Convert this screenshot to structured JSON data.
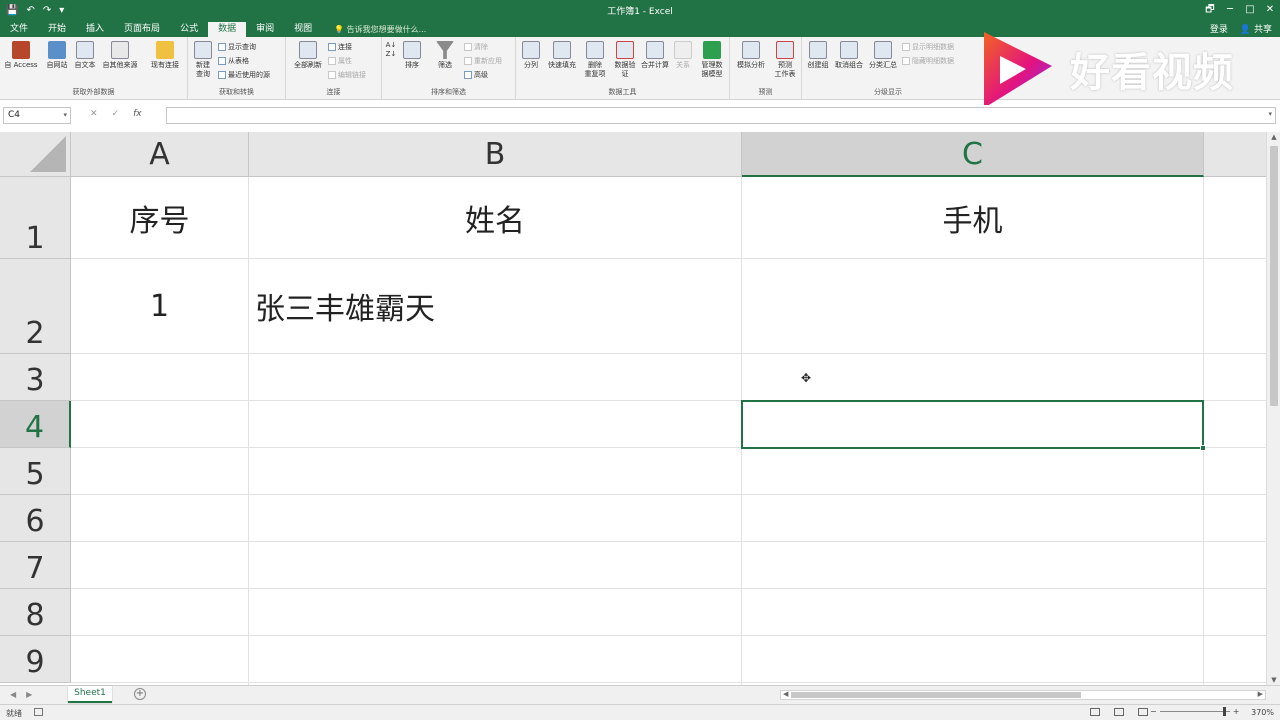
{
  "window": {
    "title": "工作簿1 - Excel",
    "qat": [
      "💾",
      "↶",
      "↷",
      "▾"
    ],
    "controls": [
      "🗗",
      "─",
      "□",
      "✕"
    ]
  },
  "tabs": {
    "items": [
      "文件",
      "开始",
      "插入",
      "页面布局",
      "公式",
      "数据",
      "审阅",
      "视图"
    ],
    "active_index": 5,
    "tell_me": "告诉我您想要做什么...",
    "login": "登录",
    "share": "共享"
  },
  "ribbon": {
    "groups": [
      {
        "label": "获取外部数据",
        "buttons": [
          "自 Access",
          "自网站",
          "自文本",
          "自其他来源",
          "现有连接"
        ]
      },
      {
        "label": "获取和转换",
        "buttons": [
          "新建\n查询"
        ],
        "small": [
          "显示查询",
          "从表格",
          "最近使用的源"
        ]
      },
      {
        "label": "连接",
        "buttons": [
          "全部刷新"
        ],
        "small": [
          "连接",
          "属性",
          "编辑链接"
        ]
      },
      {
        "label": "排序和筛选",
        "buttons": [
          "排序",
          "筛选"
        ],
        "small": [
          "清除",
          "重新应用",
          "高级"
        ]
      },
      {
        "label": "数据工具",
        "buttons": [
          "分列",
          "快速填充",
          "删除\n重复项",
          "数据验\n证",
          "合并计算",
          "关系",
          "管理数\n据模型"
        ]
      },
      {
        "label": "预测",
        "buttons": [
          "模拟分析",
          "预测\n工作表"
        ]
      },
      {
        "label": "分级显示",
        "buttons": [
          "创建组",
          "取消组合",
          "分类汇总"
        ],
        "small": [
          "显示明细数据",
          "隐藏明细数据"
        ]
      }
    ]
  },
  "watermark": {
    "text": "好看视频",
    "colors": {
      "magenta": "#e3137f",
      "orange": "#f26522",
      "purple": "#7b2ff2"
    }
  },
  "formula_bar": {
    "name_box": "C4",
    "cancel": "✕",
    "enter": "✓",
    "fx": "fx",
    "value": ""
  },
  "grid": {
    "columns": [
      "A",
      "B",
      "C"
    ],
    "selected_column": "C",
    "rows": [
      "1",
      "2",
      "3",
      "4",
      "5",
      "6",
      "7",
      "8",
      "9"
    ],
    "selected_row": "4",
    "cells": {
      "A1": "序号",
      "B1": "姓名",
      "C1": "手机",
      "A2": "1",
      "B2": "张三丰雄霸天"
    },
    "active_cell": "C4"
  },
  "sheets": {
    "tabs": [
      "Sheet1"
    ],
    "active": "Sheet1",
    "add": "+"
  },
  "status": {
    "text": "就绪",
    "zoom": "370%",
    "zoom_fraction": 0.93
  },
  "colors": {
    "excel_green": "#217346"
  }
}
